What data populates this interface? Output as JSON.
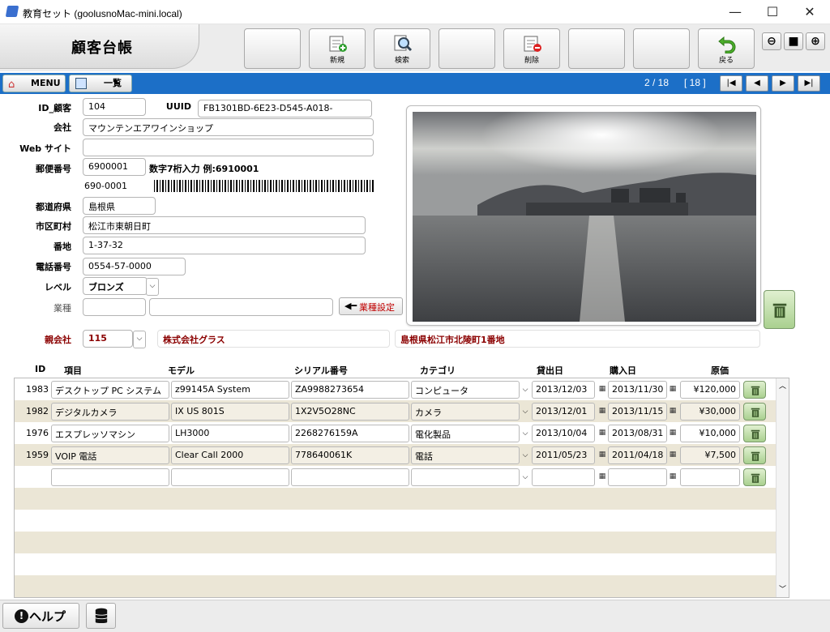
{
  "window": {
    "title": "教育セット (goolusnoMac-mini.local)",
    "minimize": "—",
    "maximize": "☐",
    "close": "✕"
  },
  "header": {
    "title": "顧客台帳"
  },
  "toolbar": {
    "new_label": "新規",
    "search_label": "検索",
    "delete_label": "削除",
    "back_label": "戻る"
  },
  "nav": {
    "menu_label": "MENU",
    "list_label": "一覧",
    "record_pos": "2 / 18",
    "record_total": "[ 18 ]"
  },
  "form": {
    "id_label": "ID_顧客",
    "id_value": "104",
    "uuid_label": "UUID",
    "uuid_value": "FB1301BD-6E23-D545-A018-",
    "company_label": "会社",
    "company_value": "マウンテンエアワインショップ",
    "website_label": "Web サイト",
    "website_value": "",
    "zip_label": "郵便番号",
    "zip_value": "6900001",
    "zip_hint": "数字7桁入力 例:6910001",
    "zip_barcode_text": "690-0001",
    "pref_label": "都道府県",
    "pref_value": "島根県",
    "city_label": "市区町村",
    "city_value": "松江市東朝日町",
    "address_label": "番地",
    "address_value": "1-37-32",
    "phone_label": "電話番号",
    "phone_value": "0554-57-0000",
    "level_label": "レベル",
    "level_value": "ブロンズ",
    "industry_label": "業種",
    "industry_value": "",
    "industry_value2": "",
    "industry_btn": "業種設定",
    "parent_label": "親会社",
    "parent_id": "115",
    "parent_name": "株式会社グラス",
    "parent_address": "島根県松江市北陵町1番地"
  },
  "table": {
    "headers": {
      "id": "ID",
      "item": "項目",
      "model": "モデル",
      "serial": "シリアル番号",
      "category": "カテゴリ",
      "lend": "貸出日",
      "buy": "購入日",
      "cost": "原価"
    },
    "rows": [
      {
        "id": "1983",
        "item": "デスクトップ PC システム",
        "model": "z99145A System",
        "serial": "ZA9988273654",
        "category": "コンピュータ",
        "lend": "2013/12/03",
        "buy": "2013/11/30",
        "cost": "¥120,000"
      },
      {
        "id": "1982",
        "item": "デジタルカメラ",
        "model": "IX US 801S",
        "serial": "1X2V5O28NC",
        "category": "カメラ",
        "lend": "2013/12/01",
        "buy": "2013/11/15",
        "cost": "¥30,000"
      },
      {
        "id": "1976",
        "item": "エスプレッソマシン",
        "model": "LH3000",
        "serial": "2268276159A",
        "category": "電化製品",
        "lend": "2013/10/04",
        "buy": "2013/08/31",
        "cost": "¥10,000"
      },
      {
        "id": "1959",
        "item": "VOIP 電話",
        "model": "Clear Call 2000",
        "serial": "778640061K",
        "category": "電話",
        "lend": "2011/05/23",
        "buy": "2011/04/18",
        "cost": "¥7,500"
      },
      {
        "id": "",
        "item": "",
        "model": "",
        "serial": "",
        "category": "",
        "lend": "",
        "buy": "",
        "cost": ""
      }
    ]
  },
  "footer": {
    "help_label": "ヘルプ"
  },
  "colors": {
    "nav_blue": "#1c6fc7",
    "row_alt": "#ebe6d6",
    "accent_red": "#cc0000",
    "trash_green": "#a9d08f"
  }
}
